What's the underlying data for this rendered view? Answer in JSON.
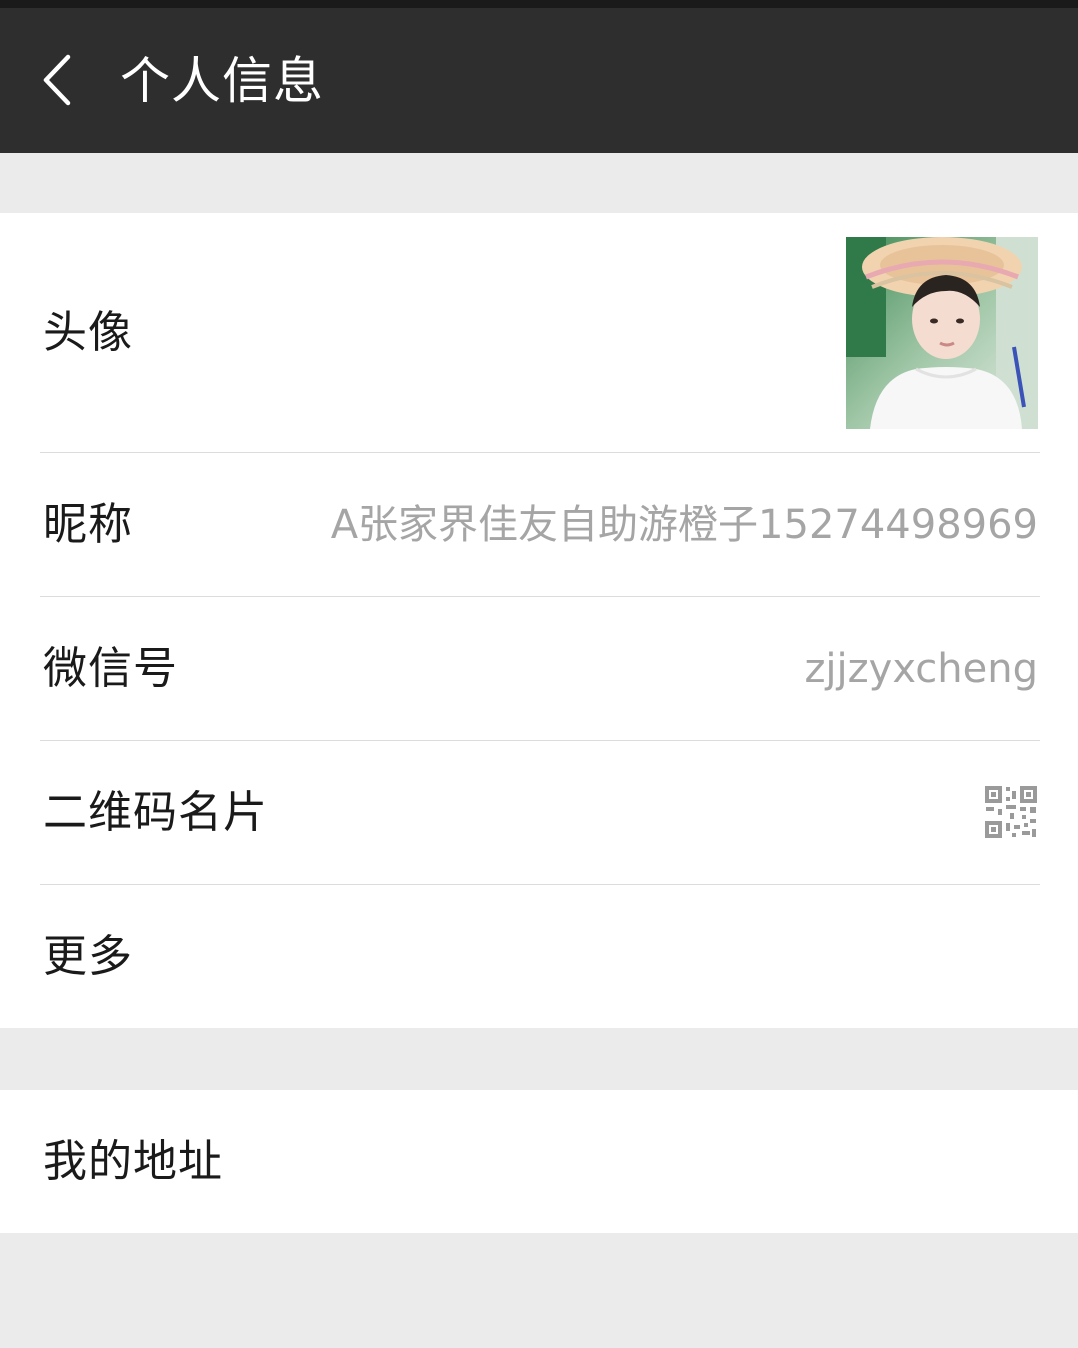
{
  "header": {
    "back_icon": "chevron-left-icon",
    "title": "个人信息"
  },
  "profile": {
    "avatar_label": "头像",
    "nickname_label": "昵称",
    "nickname_value": "A张家界佳友自助游橙子15274498969",
    "wechat_id_label": "微信号",
    "wechat_id_value": "zjjzyxcheng",
    "qr_label": "二维码名片",
    "qr_icon": "qr-code-icon",
    "more_label": "更多"
  },
  "address": {
    "label": "我的地址"
  },
  "colors": {
    "header_bg": "#2e2e2e",
    "page_bg": "#ebebeb",
    "value_text": "#a5a5a5"
  }
}
